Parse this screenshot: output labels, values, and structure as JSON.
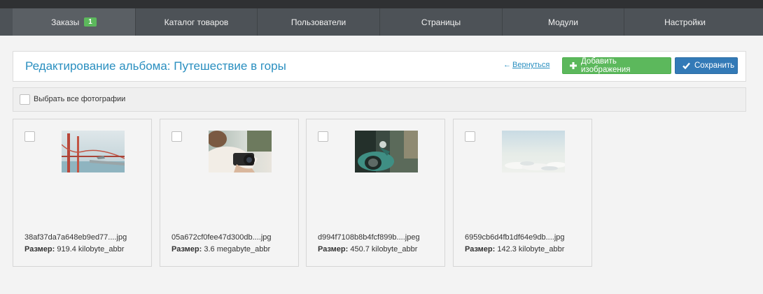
{
  "nav": {
    "items": [
      {
        "label": "Заказы",
        "badge": "1"
      },
      {
        "label": "Каталог товаров"
      },
      {
        "label": "Пользователи"
      },
      {
        "label": "Страницы"
      },
      {
        "label": "Модули"
      },
      {
        "label": "Настройки"
      }
    ]
  },
  "header": {
    "title": "Редактирование альбома: Путешествие в горы",
    "back_arrow": "←",
    "back_label": "Вернуться",
    "add_label": "Добавить изображения",
    "add_icon": "plus-icon",
    "save_label": "Сохранить",
    "save_icon": "check-icon"
  },
  "select_all": {
    "label": "Выбрать все фотографии",
    "checked": false
  },
  "size_label": "Размер:",
  "photos": [
    {
      "filename": "38af37da7a648eb9ed77....jpg",
      "size": "919.4 kilobyte_abbr",
      "checked": false,
      "thumb": "golden-gate-bridge"
    },
    {
      "filename": "05a672cf0fee47d300db....jpg",
      "size": "3.6 megabyte_abbr",
      "checked": false,
      "thumb": "person-with-camera"
    },
    {
      "filename": "d994f7108b8b4fcf899b....jpeg",
      "size": "450.7 kilobyte_abbr",
      "checked": false,
      "thumb": "green-scooter"
    },
    {
      "filename": "6959cb6d4fb1df64e9db....jpg",
      "size": "142.3 kilobyte_abbr",
      "checked": false,
      "thumb": "clouds-sky"
    }
  ],
  "colors": {
    "accent_blue": "#2a8fc0",
    "success_green": "#5cb85c",
    "primary_blue": "#337ab7",
    "nav_bg": "#4d5257"
  }
}
